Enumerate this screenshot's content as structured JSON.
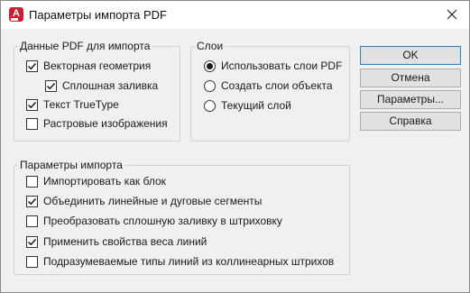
{
  "window": {
    "title": "Параметры импорта PDF"
  },
  "pdf_data_group": {
    "legend": "Данные PDF для импорта",
    "items": [
      {
        "label": "Векторная геометрия",
        "checked": true
      },
      {
        "label": "Сплошная заливка",
        "checked": true
      },
      {
        "label": "Текст TrueType",
        "checked": true
      },
      {
        "label": "Растровые изображения",
        "checked": false
      }
    ]
  },
  "layers_group": {
    "legend": "Слои",
    "options": [
      {
        "label": "Использовать слои PDF",
        "selected": true
      },
      {
        "label": "Создать слои объекта",
        "selected": false
      },
      {
        "label": "Текущий слой",
        "selected": false
      }
    ]
  },
  "import_options_group": {
    "legend": "Параметры импорта",
    "items": [
      {
        "label": "Импортировать как блок",
        "checked": false
      },
      {
        "label": "Объединить линейные и дуговые сегменты",
        "checked": true
      },
      {
        "label": "Преобразовать сплошную заливку в штриховку",
        "checked": false
      },
      {
        "label": "Применить свойства веса линий",
        "checked": true
      },
      {
        "label": "Подразумеваемые типы линий из коллинеарных штрихов",
        "checked": false
      }
    ]
  },
  "buttons": {
    "ok": "OK",
    "cancel": "Отмена",
    "settings": "Параметры...",
    "help": "Справка"
  },
  "colors": {
    "app_icon": "#c8202f",
    "default_button_border": "#3c7fb1"
  },
  "icons": {
    "app": "autocad-app-icon",
    "close": "close-icon"
  }
}
